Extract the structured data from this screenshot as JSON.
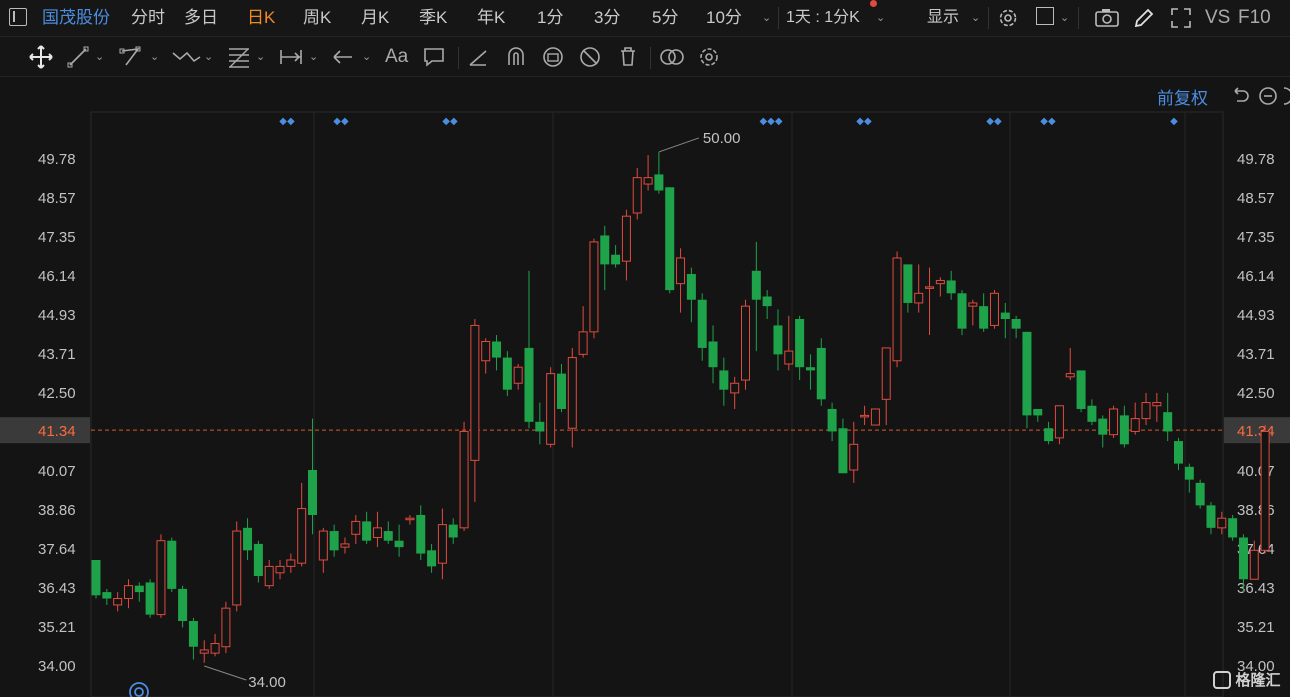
{
  "header": {
    "stock_name": "国茂股份",
    "periods": [
      "分时",
      "多日",
      "日K",
      "周K",
      "月K",
      "季K",
      "年K",
      "1分",
      "3分",
      "5分",
      "10分"
    ],
    "active_period": "日K",
    "interval_selector": "1天 : 1分K",
    "display_menu": "显示",
    "vs_label": "VS",
    "f10_label": "F10"
  },
  "chart": {
    "fuquan_label": "前复权",
    "current_price_label": "41.34",
    "high_marker": "50.00",
    "low_marker": "34.00",
    "watermark": "格隆汇"
  },
  "chart_data": {
    "type": "candlestick",
    "y_ticks": [
      "49.78",
      "48.57",
      "47.35",
      "46.14",
      "44.93",
      "43.71",
      "42.50",
      "41.34",
      "40.07",
      "38.86",
      "37.64",
      "36.43",
      "35.21",
      "34.00"
    ],
    "ylim": [
      34.0,
      49.78
    ],
    "current_price": 41.34,
    "high": 50.0,
    "low": 34.0,
    "up_color": "#e04b3f",
    "down_color": "#1fa34a",
    "candles": [
      [
        37.3,
        36.2,
        37.3,
        36.1
      ],
      [
        36.3,
        36.1,
        36.4,
        35.9
      ],
      [
        35.9,
        36.1,
        36.3,
        35.7
      ],
      [
        36.1,
        36.5,
        36.7,
        35.8
      ],
      [
        36.5,
        36.3,
        36.6,
        36.0
      ],
      [
        36.6,
        35.6,
        36.7,
        35.5
      ],
      [
        35.6,
        37.9,
        38.1,
        35.5
      ],
      [
        37.9,
        36.4,
        38.0,
        36.3
      ],
      [
        36.4,
        35.4,
        36.5,
        35.2
      ],
      [
        35.4,
        34.6,
        35.5,
        34.2
      ],
      [
        34.4,
        34.5,
        34.8,
        34.1
      ],
      [
        34.4,
        34.7,
        35.0,
        34.3
      ],
      [
        34.6,
        35.8,
        36.0,
        34.4
      ],
      [
        35.9,
        38.2,
        38.5,
        35.7
      ],
      [
        38.3,
        37.6,
        38.6,
        37.3
      ],
      [
        37.8,
        36.8,
        37.9,
        36.6
      ],
      [
        36.5,
        37.1,
        37.3,
        36.4
      ],
      [
        36.9,
        37.1,
        37.3,
        36.7
      ],
      [
        37.1,
        37.3,
        37.5,
        36.9
      ],
      [
        37.2,
        38.9,
        39.7,
        37.1
      ],
      [
        40.1,
        38.7,
        41.7,
        38.1
      ],
      [
        37.3,
        38.2,
        38.3,
        36.9
      ],
      [
        38.2,
        37.6,
        38.4,
        37.4
      ],
      [
        37.7,
        37.8,
        38.0,
        37.5
      ],
      [
        38.1,
        38.5,
        38.7,
        37.8
      ],
      [
        38.5,
        37.9,
        38.8,
        37.8
      ],
      [
        38.0,
        38.3,
        38.8,
        37.7
      ],
      [
        38.2,
        37.9,
        38.5,
        37.8
      ],
      [
        37.9,
        37.7,
        38.4,
        37.4
      ],
      [
        38.6,
        38.6,
        38.7,
        38.4
      ],
      [
        38.7,
        37.5,
        39.0,
        37.3
      ],
      [
        37.6,
        37.1,
        37.8,
        36.9
      ],
      [
        37.2,
        38.4,
        38.9,
        36.7
      ],
      [
        38.4,
        38.0,
        38.6,
        37.8
      ],
      [
        38.3,
        41.3,
        41.6,
        38.2
      ],
      [
        40.4,
        44.6,
        44.8,
        39.1
      ],
      [
        43.5,
        44.1,
        44.2,
        43.1
      ],
      [
        44.1,
        43.6,
        44.3,
        43.2
      ],
      [
        43.6,
        42.6,
        43.8,
        42.4
      ],
      [
        42.8,
        43.3,
        43.4,
        42.6
      ],
      [
        43.9,
        41.6,
        46.3,
        41.4
      ],
      [
        41.6,
        41.3,
        42.2,
        40.9
      ],
      [
        40.9,
        43.1,
        43.3,
        40.8
      ],
      [
        43.1,
        42.0,
        43.4,
        41.9
      ],
      [
        41.4,
        43.6,
        43.9,
        40.8
      ],
      [
        43.7,
        44.4,
        45.2,
        43.6
      ],
      [
        44.4,
        47.2,
        47.3,
        44.2
      ],
      [
        47.4,
        46.5,
        47.7,
        45.7
      ],
      [
        46.8,
        46.5,
        47.1,
        46.4
      ],
      [
        46.6,
        48.0,
        48.2,
        46.0
      ],
      [
        48.1,
        49.2,
        49.5,
        47.9
      ],
      [
        49.0,
        49.2,
        49.9,
        48.8
      ],
      [
        49.3,
        48.8,
        50.0,
        48.7
      ],
      [
        48.9,
        45.7,
        48.9,
        45.6
      ],
      [
        45.9,
        46.7,
        47.0,
        45.0
      ],
      [
        46.2,
        45.4,
        46.4,
        44.7
      ],
      [
        45.4,
        43.9,
        45.6,
        43.5
      ],
      [
        44.1,
        43.3,
        44.6,
        42.8
      ],
      [
        43.2,
        42.6,
        43.6,
        42.1
      ],
      [
        42.5,
        42.8,
        43.0,
        42.0
      ],
      [
        42.9,
        45.2,
        45.4,
        42.6
      ],
      [
        46.3,
        45.4,
        47.2,
        43.8
      ],
      [
        45.5,
        45.2,
        45.7,
        44.8
      ],
      [
        44.6,
        43.7,
        45.1,
        43.2
      ],
      [
        43.4,
        43.8,
        44.9,
        43.2
      ],
      [
        44.8,
        43.3,
        44.9,
        42.9
      ],
      [
        43.3,
        43.2,
        43.7,
        42.6
      ],
      [
        43.9,
        42.3,
        44.2,
        42.1
      ],
      [
        42.0,
        41.3,
        42.2,
        41.0
      ],
      [
        41.4,
        40.0,
        41.7,
        40.0
      ],
      [
        40.1,
        40.9,
        41.6,
        39.7
      ],
      [
        41.8,
        41.8,
        42.1,
        41.5
      ],
      [
        41.5,
        42.0,
        42.0,
        41.7
      ],
      [
        42.3,
        43.9,
        43.9,
        41.5
      ],
      [
        43.5,
        46.7,
        46.9,
        43.3
      ],
      [
        46.5,
        45.3,
        46.5,
        45.0
      ],
      [
        45.3,
        45.6,
        46.5,
        45.0
      ],
      [
        45.8,
        45.8,
        46.4,
        44.3
      ],
      [
        45.9,
        46.0,
        46.1,
        45.5
      ],
      [
        46.0,
        45.6,
        46.3,
        45.4
      ],
      [
        45.6,
        44.5,
        45.7,
        44.3
      ],
      [
        45.2,
        45.3,
        45.4,
        44.6
      ],
      [
        45.2,
        44.5,
        45.6,
        44.4
      ],
      [
        44.6,
        45.6,
        45.7,
        44.5
      ],
      [
        45.0,
        44.8,
        45.3,
        44.2
      ],
      [
        44.8,
        44.5,
        44.9,
        44.2
      ],
      [
        44.4,
        41.8,
        44.4,
        41.4
      ],
      [
        42.0,
        41.8,
        42.0,
        41.6
      ],
      [
        41.4,
        41.0,
        41.6,
        40.9
      ],
      [
        41.1,
        42.1,
        42.1,
        40.9
      ],
      [
        43.0,
        43.1,
        43.9,
        42.9
      ],
      [
        43.2,
        42.0,
        43.2,
        41.9
      ],
      [
        42.1,
        41.6,
        42.3,
        41.5
      ],
      [
        41.7,
        41.2,
        41.8,
        40.8
      ],
      [
        41.2,
        42.0,
        42.1,
        41.1
      ],
      [
        41.8,
        40.9,
        42.1,
        40.8
      ],
      [
        41.3,
        41.7,
        42.2,
        41.2
      ],
      [
        41.7,
        42.2,
        42.5,
        41.5
      ],
      [
        42.1,
        42.2,
        42.5,
        41.6
      ],
      [
        41.9,
        41.3,
        42.5,
        41.0
      ],
      [
        41.0,
        40.3,
        41.1,
        40.1
      ],
      [
        40.2,
        39.8,
        40.3,
        39.4
      ],
      [
        39.7,
        39.0,
        39.8,
        38.9
      ],
      [
        39.0,
        38.3,
        39.1,
        38.1
      ],
      [
        38.3,
        38.6,
        38.8,
        38.1
      ],
      [
        38.6,
        38.0,
        38.7,
        37.9
      ],
      [
        38.0,
        36.7,
        38.1,
        36.3
      ],
      [
        36.7,
        37.6,
        37.9,
        36.7
      ],
      [
        37.6,
        41.3,
        41.5,
        37.5
      ]
    ],
    "marker_dots": [
      "◆◆",
      "◆◆",
      "◆◆",
      "◆◆◆",
      "◆◆",
      "◆◆",
      "◆◆",
      "◆"
    ]
  }
}
